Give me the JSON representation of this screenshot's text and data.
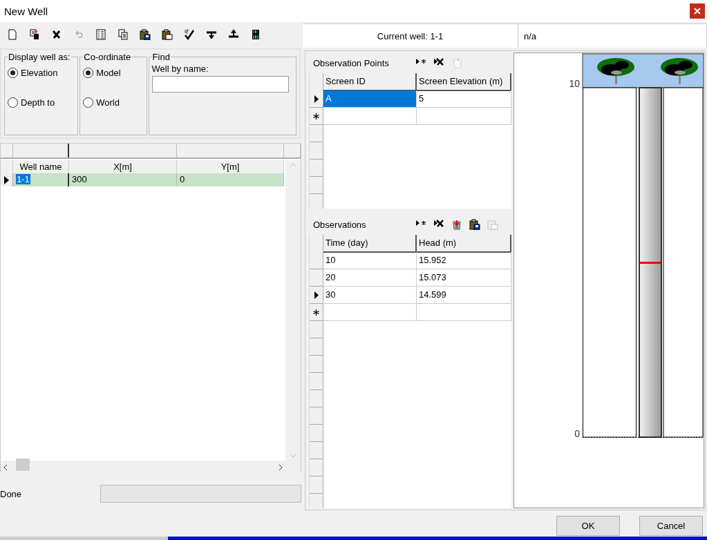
{
  "window": {
    "title": "New Well"
  },
  "toolbar": [
    {
      "kind": "new",
      "disabled": false
    },
    {
      "kind": "import",
      "disabled": false
    },
    {
      "kind": "delete",
      "disabled": false
    },
    {
      "kind": "undo",
      "disabled": true
    },
    {
      "kind": "list",
      "disabled": false
    },
    {
      "kind": "copy",
      "disabled": false
    },
    {
      "kind": "paste-save",
      "disabled": false
    },
    {
      "kind": "paste",
      "disabled": false
    },
    {
      "kind": "check",
      "disabled": false
    },
    {
      "kind": "lower",
      "disabled": false
    },
    {
      "kind": "raise",
      "disabled": false
    },
    {
      "kind": "columns",
      "disabled": false
    }
  ],
  "display_well_as": {
    "title": "Display well as:",
    "options": [
      {
        "label": "Elevation",
        "selected": true
      },
      {
        "label": "Depth to",
        "selected": false
      }
    ]
  },
  "coordinate": {
    "title": "Co-ordinate",
    "options": [
      {
        "label": "Model",
        "selected": true
      },
      {
        "label": "World",
        "selected": false
      }
    ]
  },
  "find": {
    "title": "Find",
    "label": "Well by name:"
  },
  "wells_table": {
    "columns": [
      "Well name",
      "X[m]",
      "Y[m]"
    ],
    "rows": [
      {
        "cells": [
          "1-1",
          "300",
          "0"
        ],
        "selected": true
      }
    ]
  },
  "status": {
    "text": "Done",
    "level": 0
  },
  "current_well": {
    "label": "Current well: 1-1",
    "value": "n/a"
  },
  "observation_points": {
    "title": "Observation Points",
    "columns": [
      "Screen ID",
      "Screen Elevation (m)"
    ],
    "rows": [
      {
        "cells": [
          "A",
          "5"
        ],
        "selected": true
      }
    ]
  },
  "observations": {
    "title": "Observations",
    "columns": [
      "Time (day)",
      "Head (m)"
    ],
    "rows": [
      {
        "cells": [
          "10",
          "15.952"
        ],
        "selected": false
      },
      {
        "cells": [
          "20",
          "15.073"
        ],
        "selected": false
      },
      {
        "cells": [
          "30",
          "14.599"
        ],
        "selected": true
      }
    ]
  },
  "well_diagram": {
    "axis_labels": [
      "10",
      "0"
    ]
  },
  "buttons": [
    "OK",
    "Cancel"
  ]
}
